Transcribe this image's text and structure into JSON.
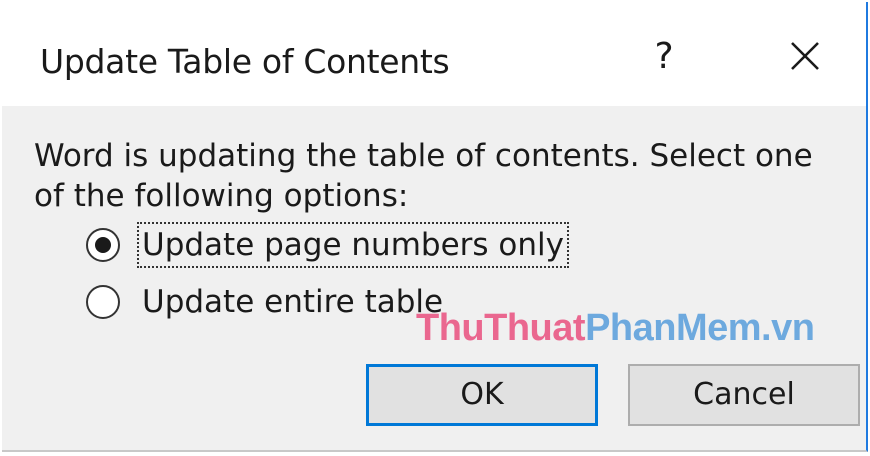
{
  "dialog": {
    "title": "Update Table of Contents",
    "help_label": "?",
    "message": "Word is updating the table of contents.  Select one\nof the following options:",
    "options": [
      {
        "label": "Update page numbers only",
        "selected": true
      },
      {
        "label": "Update entire table",
        "selected": false
      }
    ],
    "ok_label": "OK",
    "cancel_label": "Cancel",
    "accent_color": "#0078d7"
  },
  "watermark": {
    "part1": "ThuThuat",
    "part2": "PhanMem.vn"
  }
}
